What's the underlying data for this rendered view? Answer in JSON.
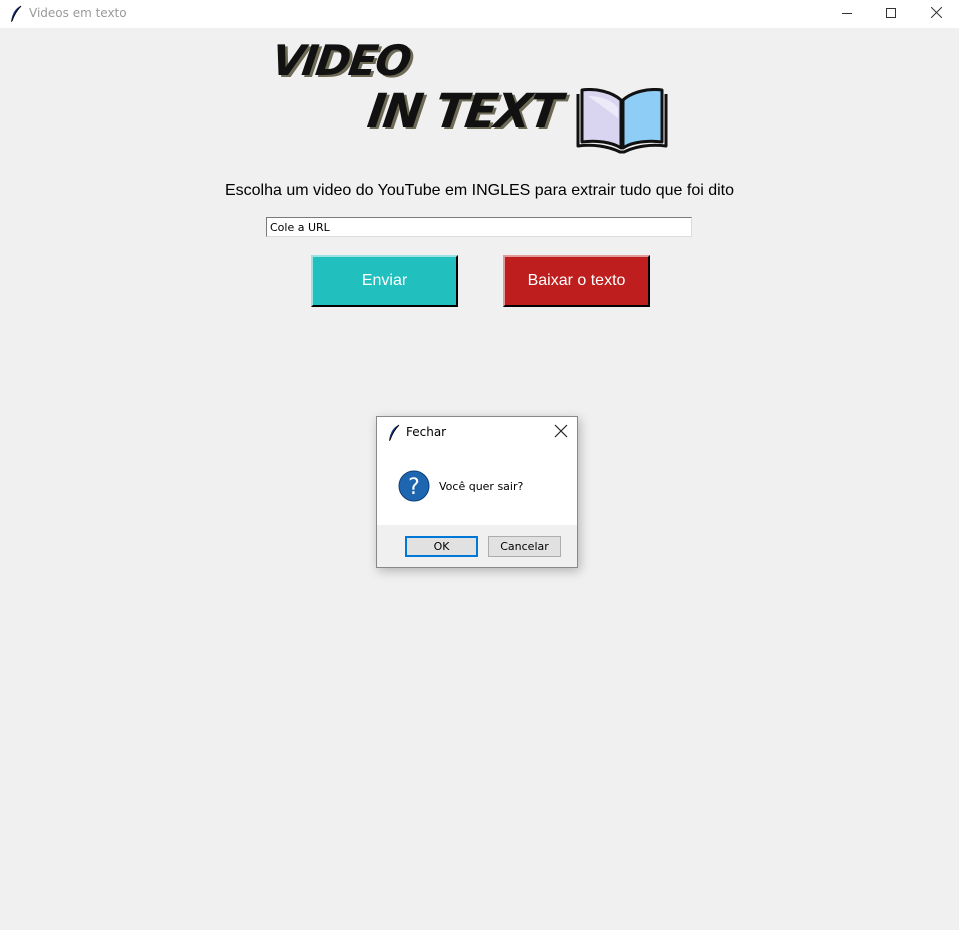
{
  "window": {
    "title": "Videos em texto",
    "icon": "feather-icon",
    "controls": [
      "minimize",
      "maximize",
      "close"
    ]
  },
  "logo": {
    "line1": "VIDEO",
    "line2": "IN TEXT",
    "icon": "open-book-icon"
  },
  "main": {
    "instruction": "Escolha um video do YouTube em INGLES para extrair tudo que foi dito",
    "url_input_value": "Cole a URL",
    "send_button": "Enviar",
    "download_button": "Baixar o texto"
  },
  "dialog": {
    "title": "Fechar",
    "message": "Você quer sair?",
    "icon": "question-icon",
    "ok_label": "OK",
    "cancel_label": "Cancelar"
  },
  "colors": {
    "background": "#f0f0f0",
    "send_button": "#21c0bf",
    "download_button": "#bf1e1e",
    "dialog_focus": "#0078d7",
    "question_icon": "#1e66b0"
  }
}
